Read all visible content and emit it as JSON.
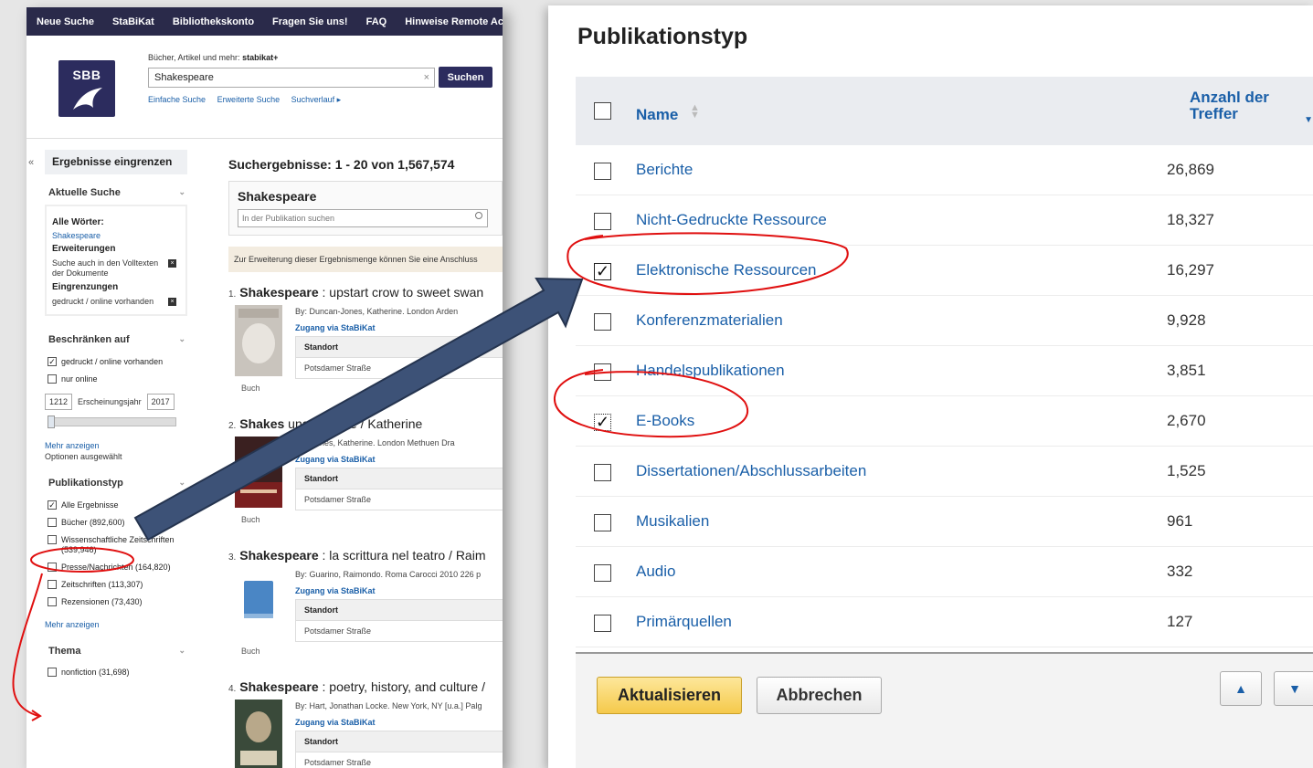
{
  "left": {
    "nav": [
      "Neue Suche",
      "StaBiKat",
      "Bibliothekskonto",
      "Fragen Sie uns!",
      "FAQ",
      "Hinweise Remote Acc"
    ],
    "logo_text": "SBB",
    "search_label": "Bücher, Artikel und mehr: ",
    "search_label_bold": "stabikat+",
    "search_value": "Shakespeare",
    "search_clear": "×",
    "search_button": "Suchen",
    "search_links": [
      "Einfache Suche",
      "Erweiterte Suche",
      "Suchverlauf ▸"
    ],
    "collapse": "«",
    "refine_title": "Ergebnisse eingrenzen",
    "current_search": {
      "header": "Aktuelle Suche",
      "all_words_label": "Alle Wörter:",
      "all_words_value": "Shakespeare",
      "extensions_label": "Erweiterungen",
      "extension_item": "Suche auch in den Volltexten der Dokumente",
      "limits_label": "Eingrenzungen",
      "limit_item": "gedruckt / online vorhanden",
      "remove": "×"
    },
    "restrict": {
      "header": "Beschränken auf",
      "opt1": "gedruckt / online vorhanden",
      "opt2": "nur online",
      "year_from": "1212",
      "year_label": "Erscheinungsjahr",
      "year_to": "2017",
      "more": "Mehr anzeigen",
      "selected": "Optionen ausgewählt"
    },
    "pubtype": {
      "header": "Publikationstyp",
      "items": [
        {
          "label": "Alle Ergebnisse",
          "checked": true
        },
        {
          "label": "Bücher (892,600)",
          "checked": false
        },
        {
          "label": "Wissenschaftliche Zeitschriften (539,946)",
          "checked": false
        },
        {
          "label": "Presse/Nachrichten (164,820)",
          "checked": false
        },
        {
          "label": "Zeitschriften (113,307)",
          "checked": false
        },
        {
          "label": "Rezensionen (73,430)",
          "checked": false
        }
      ],
      "more": "Mehr anzeigen"
    },
    "thema": {
      "header": "Thema",
      "item": "nonfiction (31,698)"
    },
    "chevron": "⌄",
    "results_count": "Suchergebnisse: 1 - 20 von 1,567,574",
    "pub_box_title": "Shakespeare",
    "pub_box_placeholder": "In der Publikation suchen",
    "note": "Zur Erweiterung dieser Ergebnismenge können Sie eine Anschluss",
    "results": [
      {
        "num": "1.",
        "title": "Shakespeare",
        "subtitle": " : upstart crow to sweet swan",
        "by": "By: Duncan-Jones, Katherine. London Arden",
        "access": "Zugang via StaBiKat",
        "loc_h": "Standort",
        "loc": "Potsdamer Straße",
        "type": "Buch"
      },
      {
        "num": "2.",
        "title": "Shakes",
        "subtitle": "     ungentle life / Katherine",
        "by": "     can-Jones, Katherine. London Methuen Dra",
        "access": "Zugang via StaBiKat",
        "loc_h": "Standort",
        "loc": "Potsdamer Straße",
        "type": "Buch"
      },
      {
        "num": "3.",
        "title": "Shakespeare",
        "subtitle": " : la scrittura nel teatro / Raim",
        "by": "By: Guarino, Raimondo. Roma Carocci 2010 226 p",
        "access": "Zugang via StaBiKat",
        "loc_h": "Standort",
        "loc": "Potsdamer Straße",
        "type": "Buch"
      },
      {
        "num": "4.",
        "title": "Shakespeare",
        "subtitle": " : poetry, history, and culture /",
        "by": "By: Hart, Jonathan Locke. New York, NY [u.a.] Palg",
        "access": "Zugang via StaBiKat",
        "loc_h": "Standort",
        "loc": "Potsdamer Straße",
        "type": ""
      }
    ]
  },
  "dialog": {
    "title": "Publikationstyp",
    "col_name": "Name",
    "col_count_1": "Anzahl der",
    "col_count_2": "Treffer",
    "rows": [
      {
        "name": "Berichte",
        "count": "26,869",
        "checked": false
      },
      {
        "name": "Nicht-Gedruckte Ressource",
        "count": "18,327",
        "checked": false
      },
      {
        "name": "Elektronische Ressourcen",
        "count": "16,297",
        "checked": true
      },
      {
        "name": "Konferenzmaterialien",
        "count": "9,928",
        "checked": false
      },
      {
        "name": "Handelspublikationen",
        "count": "3,851",
        "checked": false
      },
      {
        "name": "E-Books",
        "count": "2,670",
        "checked": true
      },
      {
        "name": "Dissertationen/Abschlussarbeiten",
        "count": "1,525",
        "checked": false
      },
      {
        "name": "Musikalien",
        "count": "961",
        "checked": false
      },
      {
        "name": "Audio",
        "count": "332",
        "checked": false
      },
      {
        "name": "Primärquellen",
        "count": "127",
        "checked": false
      }
    ],
    "btn_update": "Aktualisieren",
    "btn_cancel": "Abbrechen",
    "check_mark": "✓",
    "up_arrow": "▲",
    "down_arrow": "▼"
  },
  "colors": {
    "nav": "#2a2a4a",
    "brand": "#2c2c5e",
    "link": "#1a5fa8",
    "annotation_red": "#e01010",
    "arrow": "#3d5277"
  }
}
